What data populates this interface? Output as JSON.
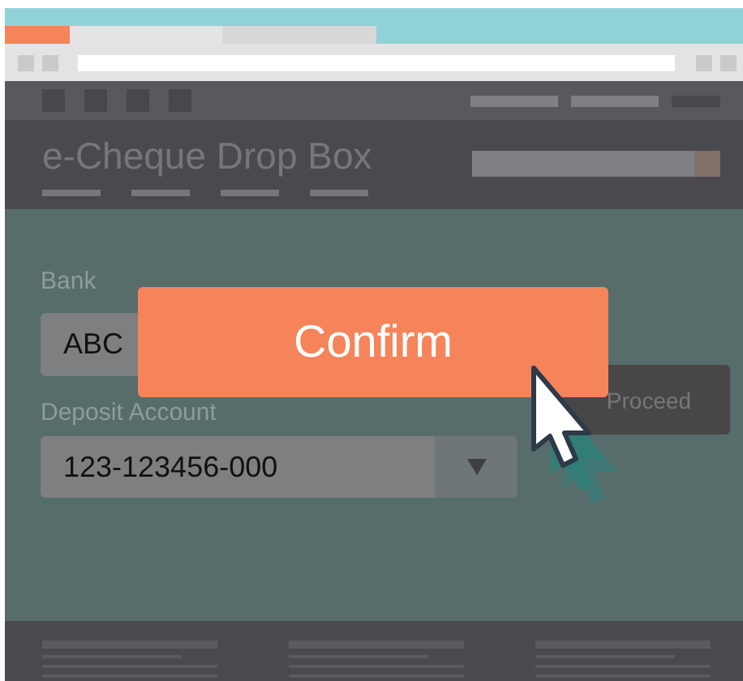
{
  "site": {
    "title": "e-Cheque Drop Box"
  },
  "form": {
    "fields": [
      {
        "kind": "text",
        "label": "Bank",
        "value": "ABC"
      },
      {
        "kind": "select",
        "label": "Deposit Account",
        "value": "123-123456-000"
      }
    ],
    "proceed": {
      "label": "Proceed"
    }
  },
  "dialog": {
    "confirm": {
      "label": "Confirm"
    }
  }
}
